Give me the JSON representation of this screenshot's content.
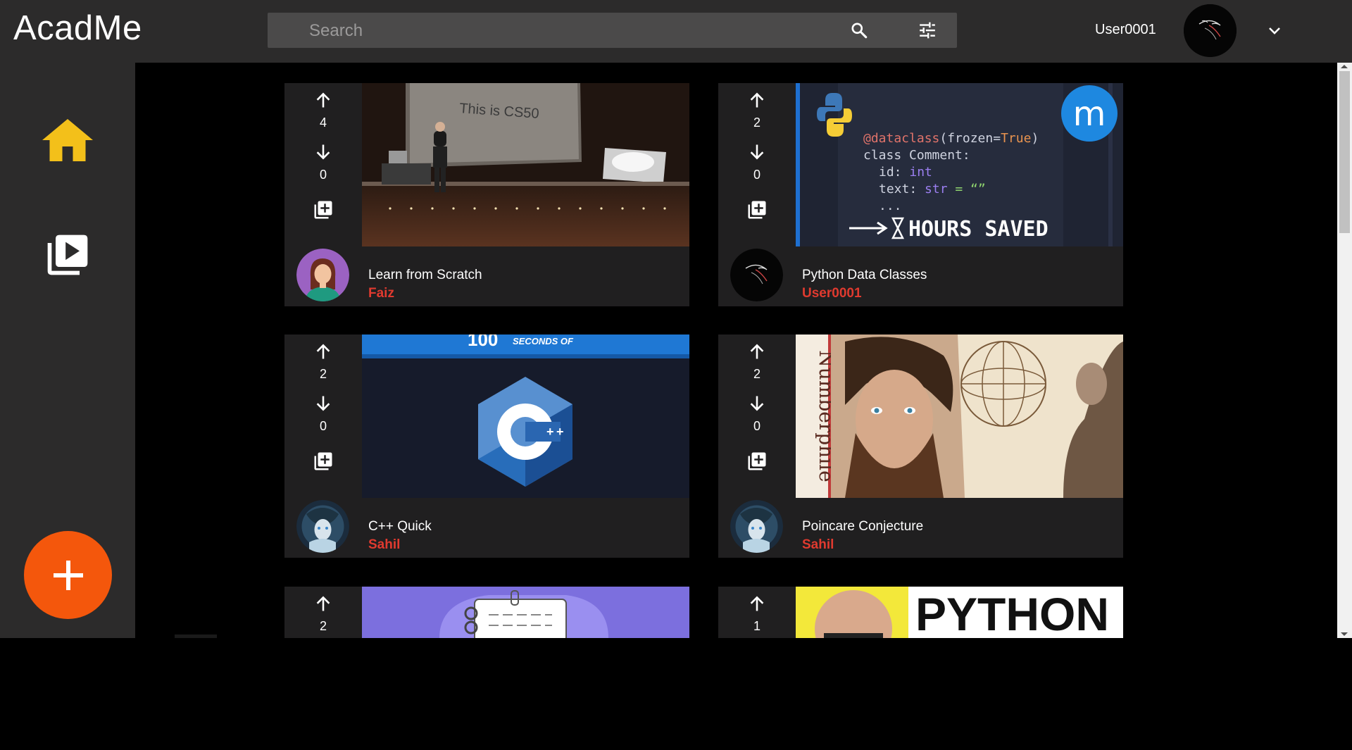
{
  "app": {
    "title": "AcadMe"
  },
  "search": {
    "placeholder": "Search"
  },
  "user": {
    "name": "User0001"
  },
  "colors": {
    "accent_home": "#f3c01a",
    "fab": "#f4570c",
    "author": "#e03a2f",
    "topbar": "#2c2b2b",
    "card": "#201f20"
  },
  "sidebar": {
    "items": [
      {
        "icon": "home-icon",
        "label": "Home"
      },
      {
        "icon": "video-library-icon",
        "label": "Library"
      }
    ],
    "fab_icon": "plus-icon"
  },
  "cards": [
    {
      "title": "Learn from Scratch",
      "author": "Faiz",
      "upvotes": "4",
      "downvotes": "0",
      "thumbnail": {
        "text": "This is CS50"
      }
    },
    {
      "title": "Python Data Classes",
      "author": "User0001",
      "upvotes": "2",
      "downvotes": "0",
      "thumbnail": {
        "line1_deco": "@dataclass",
        "line1_paren": "(frozen=",
        "line1_val": "True",
        "line1_close": ")",
        "line2": "class Comment:",
        "line3_key": "id: ",
        "line3_type": "int",
        "line4_key": "text: ",
        "line4_type": "str",
        "line4_rest": " = “”",
        "line5": "...",
        "banner": "HOURS SAVED",
        "badge": "m"
      }
    },
    {
      "title": "C++ Quick",
      "author": "Sahil",
      "upvotes": "2",
      "downvotes": "0",
      "thumbnail": {
        "banner_num": "100",
        "banner_text": "SECONDS OF",
        "logo": "C++"
      }
    },
    {
      "title": "Poincare Conjecture",
      "author": "Sahil",
      "upvotes": "2",
      "downvotes": "0",
      "thumbnail": {
        "side_text": "Numberphile"
      }
    },
    {
      "title": "",
      "author": "",
      "upvotes": "2",
      "downvotes": "",
      "thumbnail": {}
    },
    {
      "title": "",
      "author": "",
      "upvotes": "1",
      "downvotes": "",
      "thumbnail": {
        "text": "PYTHON"
      }
    }
  ]
}
